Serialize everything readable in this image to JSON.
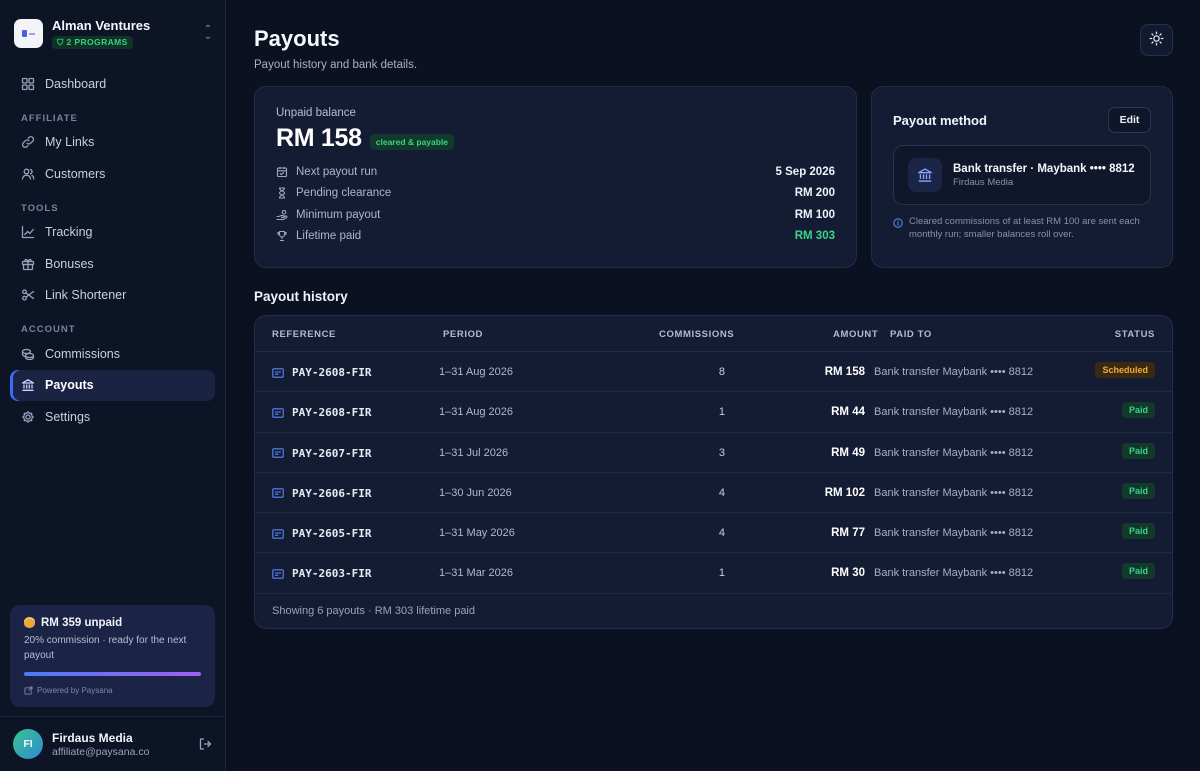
{
  "org": {
    "name": "Alman Ventures",
    "badge": "2 PROGRAMS"
  },
  "nav": {
    "dashboard": "Dashboard",
    "section_affiliate": "AFFILIATE",
    "my_links": "My Links",
    "customers": "Customers",
    "section_tools": "TOOLS",
    "tracking": "Tracking",
    "bonuses": "Bonuses",
    "link_shortener": "Link Shortener",
    "section_account": "ACCOUNT",
    "commissions": "Commissions",
    "payouts": "Payouts",
    "settings": "Settings"
  },
  "promo": {
    "title": "RM 359 unpaid",
    "subtitle": "20% commission · ready for the next payout",
    "powered": "Powered by Paysana",
    "progress": 1.0
  },
  "user": {
    "initials": "FI",
    "name": "Firdaus Media",
    "email": "affiliate@paysana.co"
  },
  "page": {
    "title": "Payouts",
    "subtitle": "Payout history and bank details."
  },
  "balance": {
    "label": "Unpaid balance",
    "amount": "RM 158",
    "badge": "cleared & payable",
    "stats": [
      {
        "icon": "calendar-icon",
        "label": "Next payout run",
        "value": "5 Sep 2026"
      },
      {
        "icon": "hourglass-icon",
        "label": "Pending clearance",
        "value": "RM 200"
      },
      {
        "icon": "hand-coins-icon",
        "label": "Minimum payout",
        "value": "RM 100"
      },
      {
        "icon": "trophy-icon",
        "label": "Lifetime paid",
        "value": "RM 303"
      }
    ]
  },
  "method": {
    "title": "Payout method",
    "edit": "Edit",
    "bank_name": "Bank transfer · Maybank •••• 8812",
    "bank_owner": "Firdaus Media",
    "note": "Cleared commissions of at least RM 100 are sent each monthly run; smaller balances roll over."
  },
  "history": {
    "title": "Payout history",
    "columns": {
      "reference": "REFERENCE",
      "period": "PERIOD",
      "commissions": "COMMISSIONS",
      "amount": "AMOUNT",
      "paid_to": "PAID TO",
      "status": "STATUS"
    },
    "rows": [
      {
        "ref": "PAY-2608-FIR",
        "period": "1–31 Aug 2026",
        "commissions": "8",
        "amount": "RM 158",
        "paid_to": "Bank transfer Maybank •••• 8812",
        "status": "Scheduled"
      },
      {
        "ref": "PAY-2608-FIR",
        "period": "1–31 Aug 2026",
        "commissions": "1",
        "amount": "RM 44",
        "paid_to": "Bank transfer Maybank •••• 8812",
        "status": "Paid"
      },
      {
        "ref": "PAY-2607-FIR",
        "period": "1–31 Jul 2026",
        "commissions": "3",
        "amount": "RM 49",
        "paid_to": "Bank transfer Maybank •••• 8812",
        "status": "Paid"
      },
      {
        "ref": "PAY-2606-FIR",
        "period": "1–30 Jun 2026",
        "commissions": "4",
        "amount": "RM 102",
        "paid_to": "Bank transfer Maybank •••• 8812",
        "status": "Paid"
      },
      {
        "ref": "PAY-2605-FIR",
        "period": "1–31 May 2026",
        "commissions": "4",
        "amount": "RM 77",
        "paid_to": "Bank transfer Maybank •••• 8812",
        "status": "Paid"
      },
      {
        "ref": "PAY-2603-FIR",
        "period": "1–31 Mar 2026",
        "commissions": "1",
        "amount": "RM 30",
        "paid_to": "Bank transfer Maybank •••• 8812",
        "status": "Paid"
      }
    ],
    "footer": "Showing 6 payouts · RM 303 lifetime paid"
  },
  "colors": {
    "accent": "#3b6cf5",
    "paid": "#38d484",
    "scheduled": "#f1ab3c",
    "background": "#0b1120"
  }
}
